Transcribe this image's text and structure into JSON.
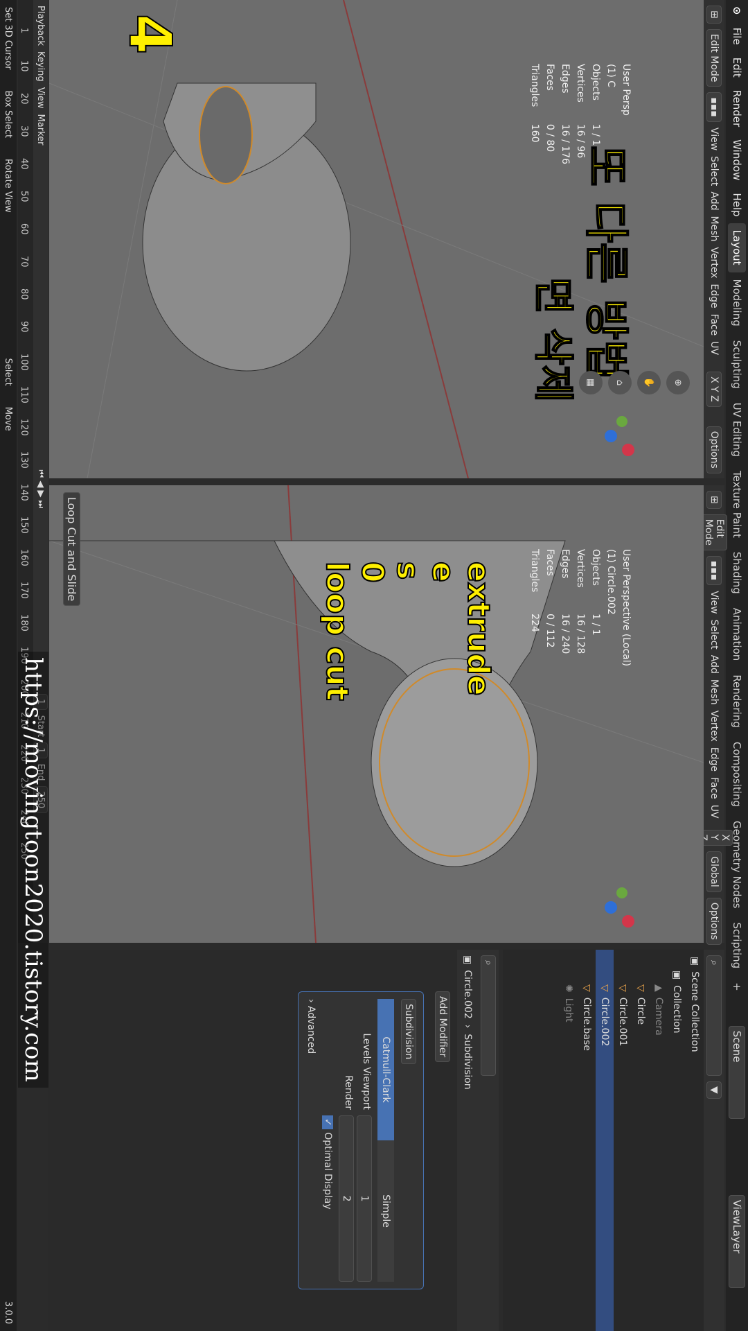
{
  "topbar": {
    "menus": [
      "File",
      "Edit",
      "Render",
      "Window",
      "Help"
    ],
    "workspace_tabs": [
      "Layout",
      "Modeling",
      "Sculpting",
      "UV Editing",
      "Texture Paint",
      "Shading",
      "Animation",
      "Rendering",
      "Compositing",
      "Geometry Nodes",
      "Scripting",
      "+"
    ],
    "scene_label": "Scene",
    "viewlayer_label": "ViewLayer"
  },
  "left_viewport": {
    "mode": "Edit Mode",
    "menus": [
      "View",
      "Select",
      "Add",
      "Mesh",
      "Vertex",
      "Edge",
      "Face",
      "UV"
    ],
    "perspective": "User Persp",
    "object": "(1) C",
    "stats": [
      [
        "Objects",
        "1 / 1"
      ],
      [
        "Vertices",
        "16 / 96"
      ],
      [
        "Edges",
        "16 / 176"
      ],
      [
        "Faces",
        "0 / 80"
      ],
      [
        "Triangles",
        "160"
      ]
    ],
    "overlay_korean": "또 다른 방법",
    "overlay_korean2": "면 삭제",
    "step_number": "4",
    "options_label": "Options",
    "axes": "X Y Z"
  },
  "right_viewport": {
    "mode": "Edit Mode",
    "menus": [
      "View",
      "Select",
      "Add",
      "Mesh",
      "Vertex",
      "Edge",
      "Face",
      "UV"
    ],
    "perspective": "User Perspective (Local)",
    "object": "(1) Circle.002",
    "stats": [
      [
        "Objects",
        "1 / 1"
      ],
      [
        "Vertices",
        "16 / 128"
      ],
      [
        "Edges",
        "16 / 240"
      ],
      [
        "Faces",
        "0 / 112"
      ],
      [
        "Triangles",
        "224"
      ]
    ],
    "annotation_lines": [
      "extrude",
      "e",
      "s",
      "0",
      "loop cut"
    ],
    "operator_panel": "Loop Cut and Slide",
    "orientation": "Global",
    "options_label": "Options",
    "axes": "X Y Z"
  },
  "outliner": {
    "title": "Scene Collection",
    "items": [
      {
        "label": "Collection",
        "depth": 1
      },
      {
        "label": "Camera",
        "depth": 2,
        "dim": true
      },
      {
        "label": "Circle",
        "depth": 2
      },
      {
        "label": "Circle.001",
        "depth": 2
      },
      {
        "label": "Circle.002",
        "depth": 2,
        "selected": true
      },
      {
        "label": "Circle.base",
        "depth": 2
      },
      {
        "label": "Light",
        "depth": 2,
        "dim": true
      }
    ]
  },
  "properties": {
    "object_name": "Circle.002",
    "modifier_name": "Subdivision",
    "add_modifier": "Add Modifier",
    "subdivision_label": "Subdivision",
    "type_options": [
      "Catmull-Clark",
      "Simple"
    ],
    "levels_viewport_label": "Levels Viewport",
    "levels_viewport_value": "1",
    "render_label": "Render",
    "render_value": "2",
    "optimal_display": "Optimal Display",
    "advanced": "Advanced"
  },
  "timeline": {
    "menus": [
      "Playback",
      "Keying",
      "View",
      "Marker"
    ],
    "ticks": [
      "1",
      "10",
      "20",
      "30",
      "40",
      "50",
      "60",
      "70",
      "80",
      "90",
      "100",
      "110",
      "120",
      "130",
      "140",
      "150",
      "160",
      "170",
      "180",
      "190",
      "200",
      "210",
      "220",
      "230",
      "240",
      "250"
    ],
    "current_frame": "1",
    "start_label": "Start",
    "start_value": "1",
    "end_label": "End",
    "end_value": "250"
  },
  "statusbar": {
    "items": [
      "Set 3D Cursor",
      "Box Select",
      "Rotate View",
      "Select",
      "Move"
    ],
    "version": "3.0.0"
  },
  "watermark": "https://movingtoon2020.tistory.com",
  "colors": {
    "accent": "#4772b3",
    "annotation": "#fff000",
    "viewport": "#6d6d6d"
  }
}
